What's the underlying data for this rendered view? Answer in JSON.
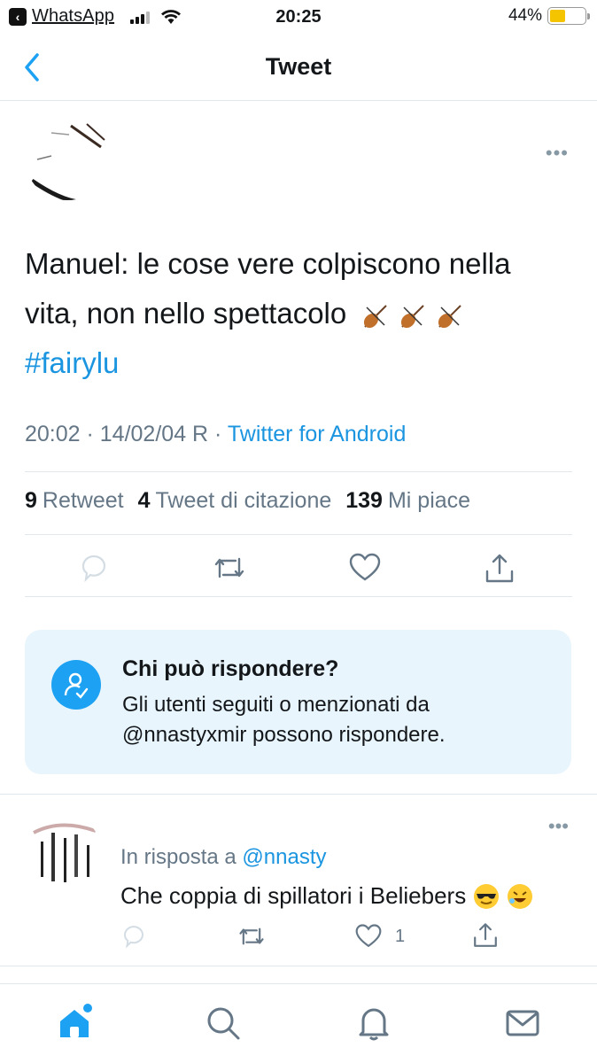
{
  "status_bar": {
    "back_app": "WhatsApp",
    "time": "20:25",
    "battery": "44%",
    "battery_level": 0.44
  },
  "nav": {
    "title": "Tweet"
  },
  "tweet": {
    "text_line1": "Manuel: le cose vere colpiscono nella",
    "text_line2": "vita, non nello spettacolo",
    "hashtag": "#fairylu",
    "time_date": "20:02 · 14/02/04 R ·",
    "source": "Twitter for Android",
    "stats": {
      "retweets_count": "9",
      "retweets_label": "Retweet",
      "quotes_count": "4",
      "quotes_label": "Tweet di citazione",
      "likes_count": "139",
      "likes_label": "Mi piace"
    }
  },
  "who_can_reply": {
    "title": "Chi può rispondere?",
    "description": "Gli utenti seguiti o menzionati da @nnastyxmir possono rispondere."
  },
  "reply": {
    "reply_to_label": "In risposta a",
    "reply_to_handle": "@nnasty",
    "text": "Che coppia di spillatori i Beliebers",
    "like_count": "1"
  },
  "colors": {
    "accent": "#1da1f2",
    "link": "#1b95e0",
    "muted": "#657786",
    "box_bg": "#e8f5fd"
  }
}
